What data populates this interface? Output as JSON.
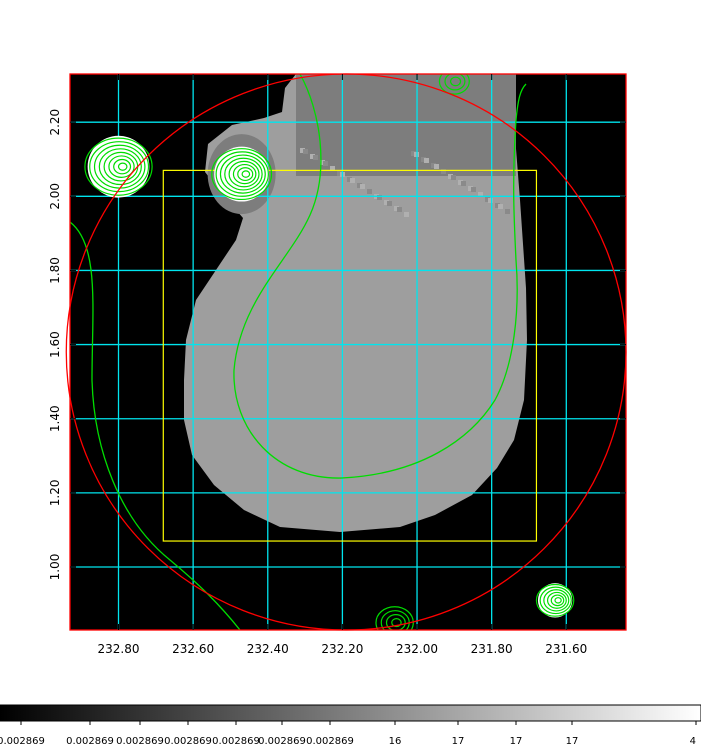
{
  "chart_data": {
    "type": "heatmap",
    "title": "",
    "xlabel": "",
    "ylabel": "",
    "xlim": [
      232.93,
      231.44
    ],
    "ylim": [
      0.83,
      2.33
    ],
    "x_axis_reversed": true,
    "x_ticks": [
      232.8,
      232.6,
      232.4,
      232.2,
      232.0,
      231.8,
      231.6
    ],
    "x_tick_labels": [
      "232.80",
      "232.60",
      "232.40",
      "232.20",
      "232.00",
      "231.80",
      "231.60"
    ],
    "y_ticks": [
      1.0,
      1.2,
      1.4,
      1.6,
      1.8,
      2.0,
      2.2
    ],
    "y_tick_labels": [
      "1.00",
      "1.20",
      "1.40",
      "1.60",
      "1.80",
      "2.00",
      "2.20"
    ],
    "grid": true,
    "colormap": "gray",
    "colorbar": {
      "position": "bottom",
      "tick_labels": [
        "0.002869",
        "0.002869",
        "0.002869",
        "0.002869",
        "0.002869",
        "0.002869",
        "0.002869",
        "16",
        "17",
        "17",
        "17",
        "4"
      ]
    },
    "overlays": {
      "circle": {
        "center": [
          232.19,
          1.58
        ],
        "radius": 0.75
      },
      "box": {
        "x": [
          232.68,
          231.68
        ],
        "y": [
          1.07,
          2.07
        ]
      }
    },
    "contour_sources": [
      {
        "x": [
          232.8,
          2.08
        ],
        "rings": 8,
        "size": 0.09
      },
      {
        "x": [
          232.47,
          2.06
        ],
        "rings": 8,
        "size": 0.08
      },
      {
        "x": [
          232.06,
          0.85
        ],
        "rings": 4,
        "size": 0.05
      },
      {
        "x": [
          231.63,
          0.91
        ],
        "rings": 6,
        "size": 0.05
      },
      {
        "x": [
          231.9,
          2.31
        ],
        "rings": 3,
        "size": 0.04
      }
    ],
    "colors": {
      "background": "#000000",
      "image_gray": "#9e9e9e",
      "image_gray_dark": "#7d7d7d",
      "grid": "#00e5ee",
      "circle": "#ff0000",
      "box": "#ffff00",
      "contours": "#00dd00"
    }
  }
}
